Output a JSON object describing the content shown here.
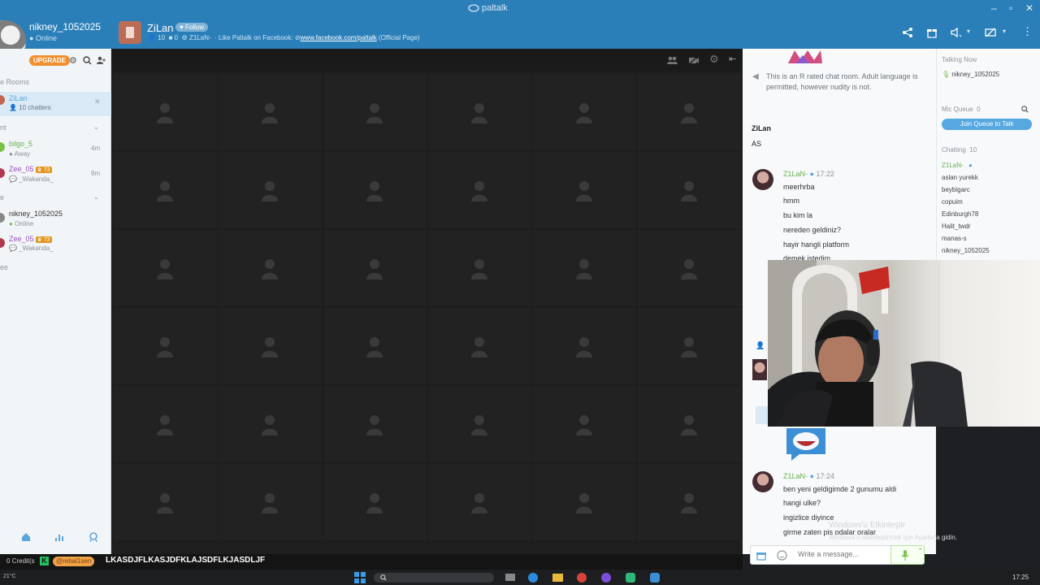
{
  "window": {
    "title": "paltalk",
    "controls": {
      "minimize": "–",
      "maximize": "▫",
      "close": "✕"
    }
  },
  "user": {
    "name": "nikney_1052025",
    "status": "Online"
  },
  "room": {
    "title": "ZiLan",
    "follow_label": "Follow",
    "chatters_count": "10",
    "mic_count": "0",
    "cam_count": "0",
    "owner": "Z1LaN-",
    "facebook_prefix": "Like Paltalk on Facebook:",
    "facebook_link": "www.facebook.com/paltalk",
    "facebook_suffix": "(Official Page)"
  },
  "sidebar": {
    "upgrade_label": "UPGRADE",
    "rooms_section": "e Rooms",
    "room_item": {
      "name": "ZiLan",
      "sub": "10 chatters"
    },
    "recent_section": "nt",
    "recent": [
      {
        "name": "bilgo_5",
        "sub": "Away",
        "time": "4m",
        "color": "#69b04f"
      },
      {
        "name": "Zee_05",
        "badge": "73",
        "sub": "_Wakanda_",
        "time": "9m",
        "color": "#9b4fbf"
      }
    ],
    "contacts_section": "e",
    "contacts": [
      {
        "name": "nikney_1052025",
        "sub": "Online",
        "color": "#333"
      },
      {
        "name": "Zee_05",
        "badge": "73",
        "sub": "_Wakanda_",
        "color": "#9b4fbf"
      }
    ],
    "more_section": "ee"
  },
  "bottom_bar": {
    "credits": "0 Credit(s",
    "ticker_badge": "K",
    "ticker_user": "@rebal1sen",
    "ticker_text": "LKASDJFLKASJDFKLAJSDFLKJASDLJF"
  },
  "chat": {
    "notice": "This is an R rated chat room. Adult language is permitted, however nudity is not.",
    "host_name": "ZiLan",
    "host_message": "AS",
    "groups": [
      {
        "author": "Z1LaN-",
        "time": "17:22",
        "messages": [
          "meerhrba",
          "hmm",
          "bu kim la",
          "nereden geldiniz?",
          "hayir hangli platform",
          "demek istedim"
        ]
      },
      {
        "author": "Z1LaN-",
        "time": "17:24",
        "messages": [
          "ben yeni geldigimde 2 gunumu aldi",
          "hangi ulke?",
          "ingizlice diyince",
          "girme zaten pis odalar oralar"
        ]
      }
    ],
    "composer_placeholder": "Write a message..."
  },
  "user_pane": {
    "talking_label": "Talking Now",
    "talking_user": "nikney_1052025",
    "mic_queue_label": "Mic Queue",
    "mic_queue_count": "0",
    "join_queue_label": "Join Queue to Talk",
    "chatting_label": "Chatting",
    "chatting_count": "10",
    "chatters": [
      "Z1LaN-",
      "aslan yurekk",
      "beybigarc",
      "copuim",
      "Edinburgh78",
      "Halit_twdr",
      "manas-s",
      "nikney_1052025"
    ]
  },
  "windows_watermark": {
    "line1": "Windows'u Etkinleştir",
    "line2": "Windows'u etkinleştirmek için Ayarlar'a gidin."
  },
  "taskbar": {
    "temperature": "21°C",
    "clock": "17:25"
  }
}
